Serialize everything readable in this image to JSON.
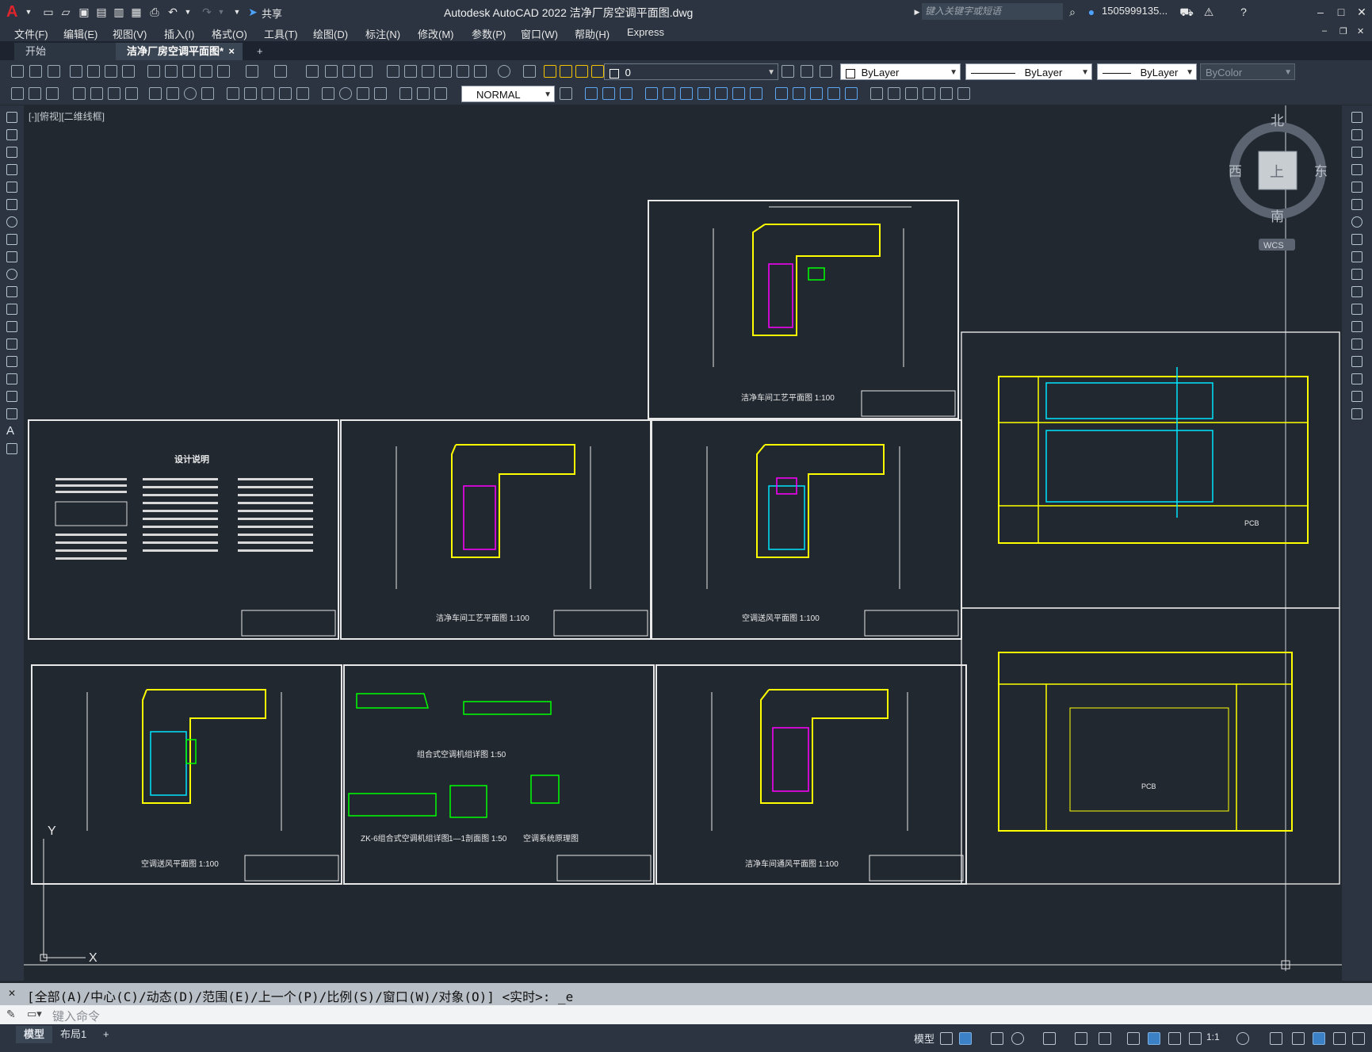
{
  "app": {
    "title": "Autodesk AutoCAD 2022    洁净厂房空调平面图.dwg",
    "logo": "A",
    "share_label": "共享",
    "search_placeholder": "键入关键字或短语",
    "user_name": "1505999135..."
  },
  "menu": [
    "文件(F)",
    "编辑(E)",
    "视图(V)",
    "插入(I)",
    "格式(O)",
    "工具(T)",
    "绘图(D)",
    "标注(N)",
    "修改(M)",
    "参数(P)",
    "窗口(W)",
    "帮助(H)",
    "Express"
  ],
  "tabs": {
    "start": "开始",
    "doc": "洁净厂房空调平面图*",
    "doc_close": "×",
    "add": "+"
  },
  "toolbar": {
    "layer_value": "0",
    "color_value": "ByLayer",
    "linetype_value": "ByLayer",
    "lineweight_value": "ByLayer",
    "plotstyle_value": "ByColor",
    "textstyle_value": "NORMAL"
  },
  "viewport": {
    "label": "[-][俯视][二维线框]",
    "viewcube": {
      "north": "北",
      "south": "南",
      "east": "东",
      "west": "西",
      "top": "上",
      "wcs": "WCS"
    },
    "ucs": {
      "x": "X",
      "y": "Y"
    }
  },
  "sheets": {
    "design_notes_title": "设计说明",
    "titles": [
      "洁净车间工艺平面图  1:100",
      "洁净车间工艺平面图  1:100",
      "空调送风平面图  1:100",
      "空调送风平面图  1:100",
      "洁净车间通风平面图  1:100",
      "组合式空调机组详图  1:50",
      "ZK-6组合式空调机组详图",
      "1—1剖面图  1:50",
      "空调系统原理图"
    ],
    "plan_labels": [
      "PCB",
      "PCB"
    ]
  },
  "command": {
    "history": "[全部(A)/中心(C)/动态(D)/范围(E)/上一个(P)/比例(S)/窗口(W)/对象(O)] <实时>: _e",
    "placeholder": "键入命令"
  },
  "status": {
    "layout_tabs": [
      "模型",
      "布局1"
    ],
    "add_layout": "+",
    "model_label": "模型",
    "scale": "1:1"
  },
  "colors": {
    "canvas_bg": "#212830",
    "sheet_frame": "#e8e8e8",
    "wall_yellow": "#ffff00",
    "duct_cyan": "#00e5ff",
    "duct_magenta": "#ff00ff",
    "equip_green": "#00ff00"
  }
}
